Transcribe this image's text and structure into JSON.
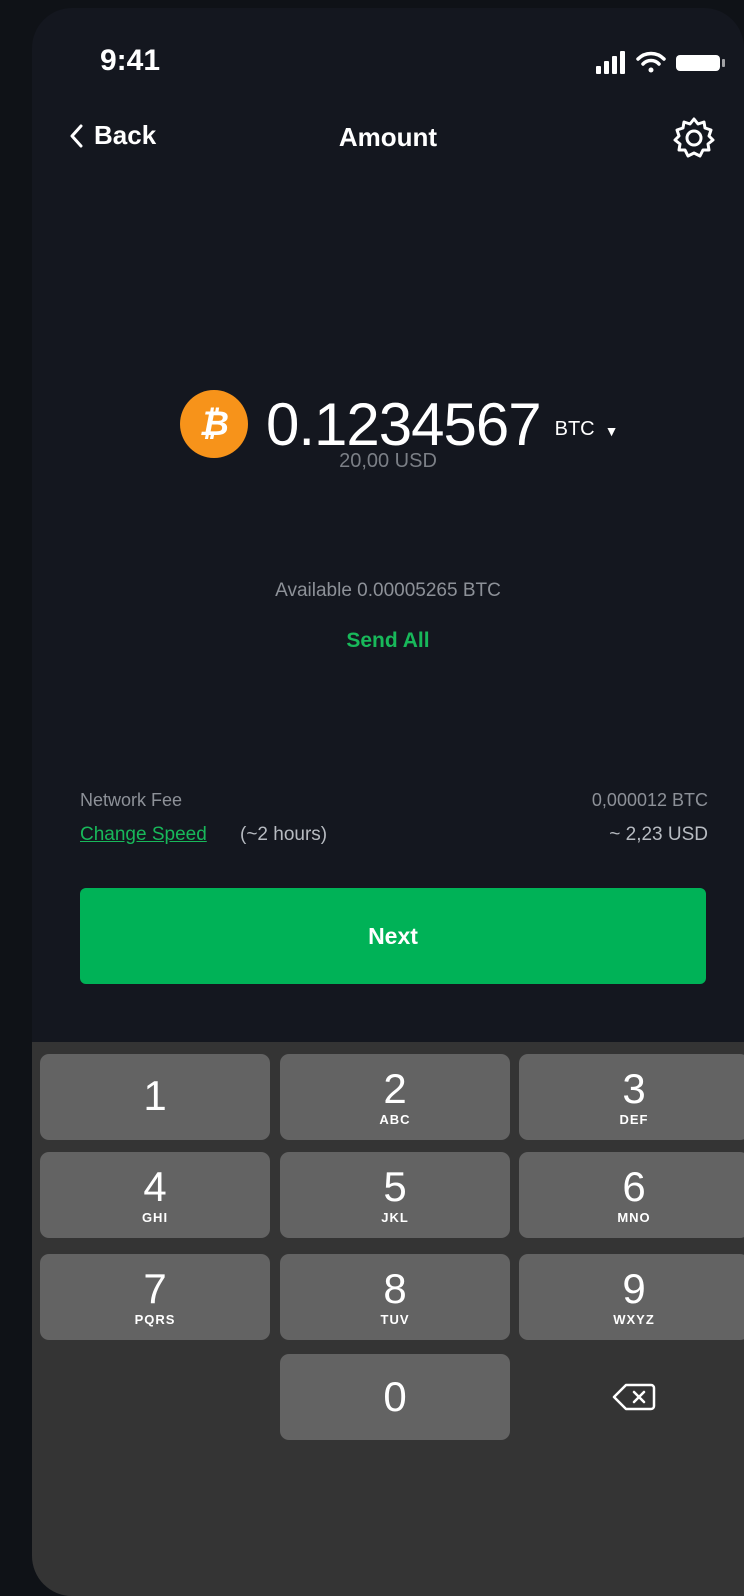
{
  "status_bar": {
    "time": "9:41"
  },
  "nav": {
    "back_label": "Back",
    "title": "Amount"
  },
  "amount": {
    "value": "0.1234567",
    "unit": "BTC",
    "fiat": "20,00 USD",
    "coin_symbol": "₿"
  },
  "balance": {
    "available": "Available 0.00005265 BTC",
    "send_all": "Send All"
  },
  "fee": {
    "label": "Network Fee",
    "btc": "0,000012 BTC",
    "change_speed": "Change Speed",
    "time": "(~2 hours)",
    "usd": "~ 2,23 USD"
  },
  "next_label": "Next",
  "keypad": {
    "keys": [
      {
        "num": "1",
        "letters": ""
      },
      {
        "num": "2",
        "letters": "ABC"
      },
      {
        "num": "3",
        "letters": "DEF"
      },
      {
        "num": "4",
        "letters": "GHI"
      },
      {
        "num": "5",
        "letters": "JKL"
      },
      {
        "num": "6",
        "letters": "MNO"
      },
      {
        "num": "7",
        "letters": "PQRS"
      },
      {
        "num": "8",
        "letters": "TUV"
      },
      {
        "num": "9",
        "letters": "WXYZ"
      },
      {
        "num": "0",
        "letters": ""
      }
    ]
  },
  "colors": {
    "accent": "#00b257",
    "bitcoin": "#f7931a",
    "background": "#14171f"
  }
}
